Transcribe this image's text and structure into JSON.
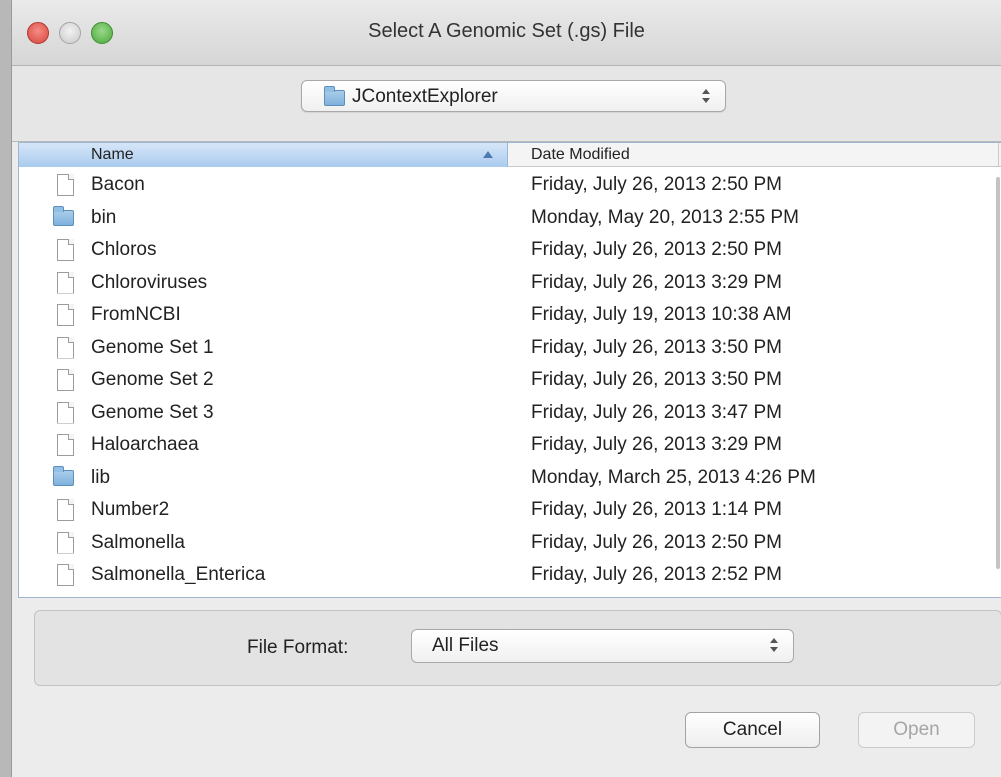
{
  "window": {
    "title": "Select A Genomic Set (.gs) File"
  },
  "location": {
    "selected": "JContextExplorer",
    "icon": "folder-icon"
  },
  "file_list": {
    "columns": {
      "name": "Name",
      "date": "Date Modified"
    },
    "sort": "name-ascending",
    "items": [
      {
        "name": "Bacon",
        "date": "Friday, July 26, 2013 2:50 PM",
        "icon": "document-icon"
      },
      {
        "name": "bin",
        "date": "Monday, May 20, 2013 2:55 PM",
        "icon": "folder-icon"
      },
      {
        "name": "Chloros",
        "date": "Friday, July 26, 2013 2:50 PM",
        "icon": "document-icon"
      },
      {
        "name": "Chloroviruses",
        "date": "Friday, July 26, 2013 3:29 PM",
        "icon": "document-icon"
      },
      {
        "name": "FromNCBI",
        "date": "Friday, July 19, 2013 10:38 AM",
        "icon": "document-icon"
      },
      {
        "name": "Genome Set 1",
        "date": "Friday, July 26, 2013 3:50 PM",
        "icon": "document-icon"
      },
      {
        "name": "Genome Set 2",
        "date": "Friday, July 26, 2013 3:50 PM",
        "icon": "document-icon"
      },
      {
        "name": "Genome Set 3",
        "date": "Friday, July 26, 2013 3:47 PM",
        "icon": "document-icon"
      },
      {
        "name": "Haloarchaea",
        "date": "Friday, July 26, 2013 3:29 PM",
        "icon": "document-icon"
      },
      {
        "name": "lib",
        "date": "Monday, March 25, 2013 4:26 PM",
        "icon": "folder-icon"
      },
      {
        "name": "Number2",
        "date": "Friday, July 26, 2013 1:14 PM",
        "icon": "document-icon"
      },
      {
        "name": "Salmonella",
        "date": "Friday, July 26, 2013 2:50 PM",
        "icon": "document-icon"
      },
      {
        "name": "Salmonella_Enterica",
        "date": "Friday, July 26, 2013 2:52 PM",
        "icon": "document-icon"
      }
    ]
  },
  "format": {
    "label": "File Format:",
    "selected": "All Files"
  },
  "buttons": {
    "cancel": "Cancel",
    "open": "Open"
  },
  "colors": {
    "header_selected": "#aacbee",
    "folder": "#8fbde5",
    "close": "#e0574d",
    "maximize": "#5fba4c"
  }
}
